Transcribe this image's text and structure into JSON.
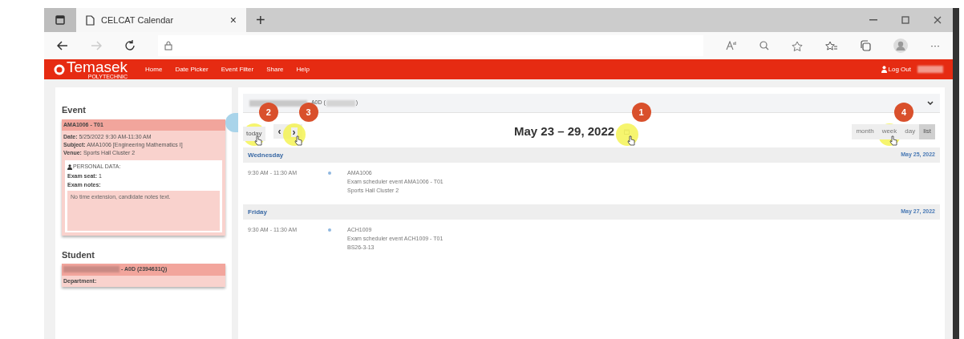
{
  "browser": {
    "tab_title": "CELCAT Calendar",
    "new_tab": "+",
    "close_tab": "×",
    "more": "···"
  },
  "app": {
    "logo": "Temasek",
    "logo_sub": "POLYTECHNIC",
    "nav": [
      "Home",
      "Date Picker",
      "Event Filter",
      "Share",
      "Help"
    ],
    "logout": "Log Out"
  },
  "event_panel": {
    "heading": "Event",
    "event_title": "AMA1006 - T01",
    "fields": [
      {
        "label": "Date:",
        "value": "5/25/2022 9:30 AM-11:30 AM"
      },
      {
        "label": "Subject:",
        "value": "AMA1006 [Engineering Mathematics I]"
      },
      {
        "label": "Venue:",
        "value": "Sports Hall Cluster 2"
      }
    ],
    "personal_heading": "PERSONAL DATA:",
    "exam_seat_label": "Exam seat:",
    "exam_seat": "1",
    "exam_notes_label": "Exam notes:",
    "exam_notes": "No time extension, candidate notes text."
  },
  "student_panel": {
    "heading": "Student",
    "name": "- A0D (2394631Q)",
    "department_label": "Department:"
  },
  "calendar": {
    "selector": {
      "text_before": "- A0D (",
      "text_after": ")"
    },
    "today": "today",
    "prev": "‹",
    "next": "›",
    "title": "May 23 – 29, 2022",
    "views": [
      {
        "label": "month",
        "selected": false
      },
      {
        "label": "week",
        "selected": false
      },
      {
        "label": "day",
        "selected": false
      },
      {
        "label": "list",
        "selected": true
      }
    ],
    "days": [
      {
        "day": "Wednesday",
        "date": "May 25, 2022",
        "events": [
          {
            "time": "9:30 AM - 11:30 AM",
            "lines": [
              "AMA1006",
              "Exam scheduler event AMA1006 - T01",
              "Sports Hall Cluster 2"
            ]
          }
        ]
      },
      {
        "day": "Friday",
        "date": "May 27, 2022",
        "events": [
          {
            "time": "9:30 AM - 11:30 AM",
            "lines": [
              "ACH1009",
              "Exam scheduler event ACH1009 - T01",
              "BS26-3-13"
            ]
          }
        ]
      }
    ]
  },
  "annotations": [
    {
      "number": "2"
    },
    {
      "number": "3"
    },
    {
      "number": "1"
    },
    {
      "number": "4"
    }
  ]
}
